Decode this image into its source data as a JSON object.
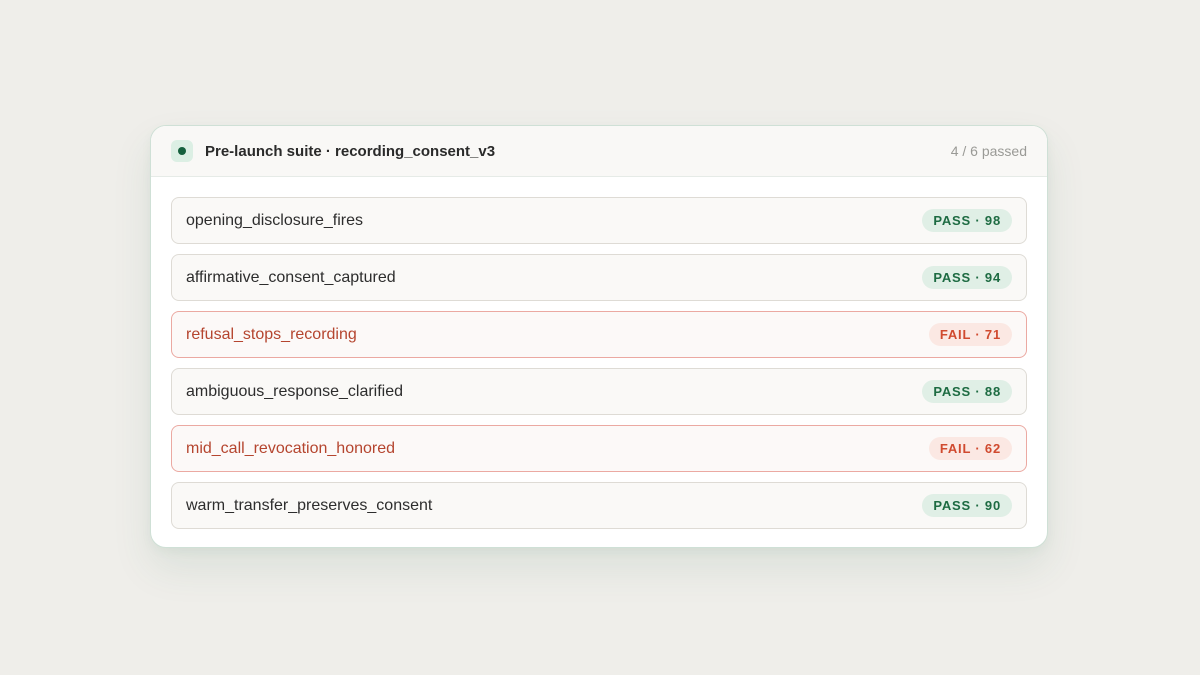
{
  "colors": {
    "page_background": "#efeeea",
    "pass_text": "#1d6b42",
    "pass_badge_bg": "#e0efe6",
    "fail_text": "#d04a2f",
    "fail_badge_bg": "#fbe8e3",
    "fail_name": "#b5452f",
    "status_dot": "#15603d"
  },
  "header": {
    "status_icon": "green-dot-icon",
    "title": "Pre-launch suite · recording_consent_v3",
    "summary": "4 / 6 passed"
  },
  "tests": [
    {
      "name": "opening_disclosure_fires",
      "status": "pass",
      "badge": "PASS · 98"
    },
    {
      "name": "affirmative_consent_captured",
      "status": "pass",
      "badge": "PASS · 94"
    },
    {
      "name": "refusal_stops_recording",
      "status": "fail",
      "badge": "FAIL · 71"
    },
    {
      "name": "ambiguous_response_clarified",
      "status": "pass",
      "badge": "PASS · 88"
    },
    {
      "name": "mid_call_revocation_honored",
      "status": "fail",
      "badge": "FAIL · 62"
    },
    {
      "name": "warm_transfer_preserves_consent",
      "status": "pass",
      "badge": "PASS · 90"
    }
  ]
}
